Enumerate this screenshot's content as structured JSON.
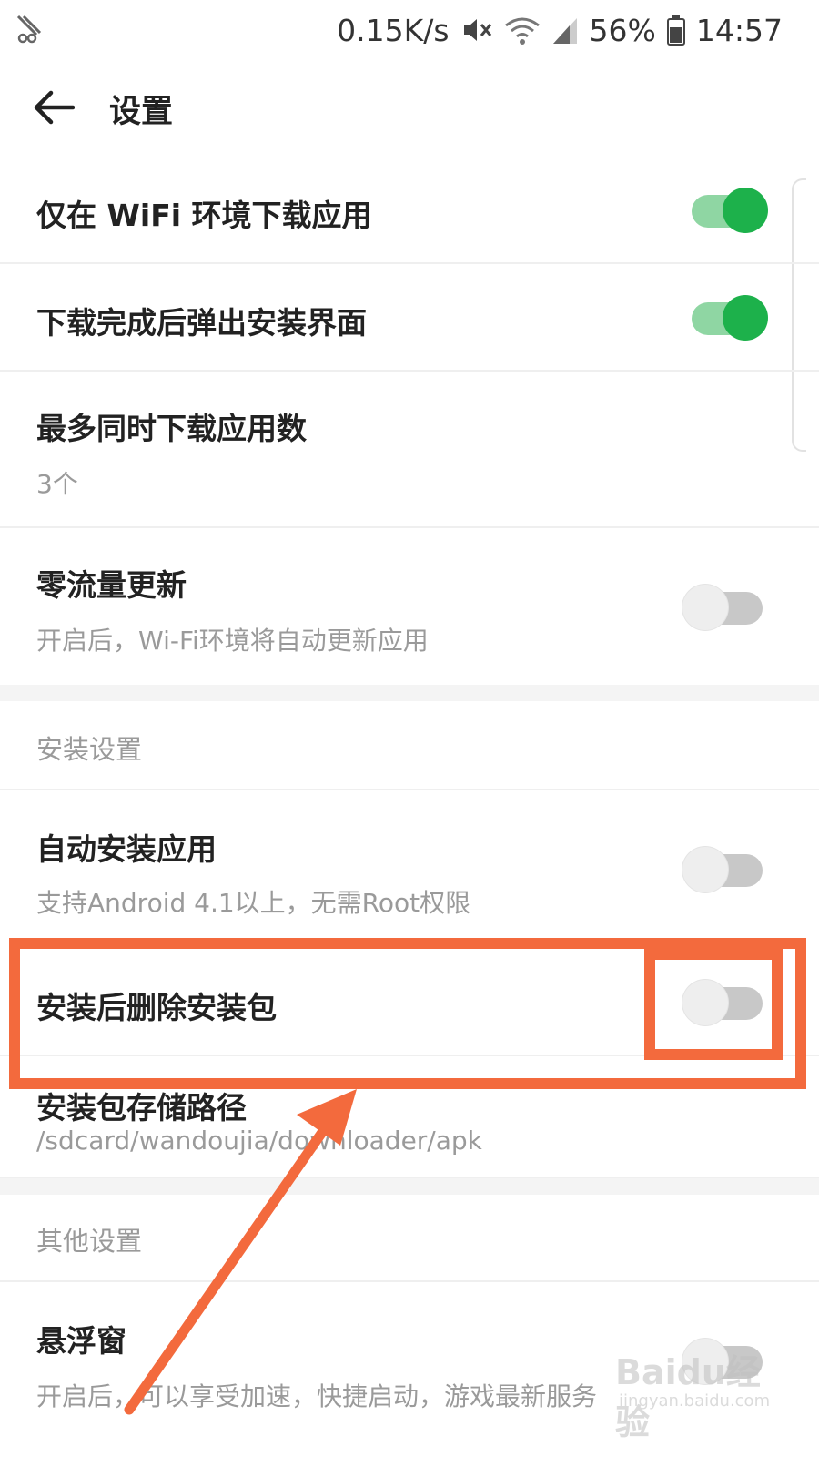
{
  "status_bar": {
    "net_speed": "0.15K/s",
    "battery_percent": "56%",
    "time": "14:57",
    "icons": [
      "app-notification-icon",
      "mute-icon",
      "wifi-icon",
      "signal-icon",
      "battery-icon"
    ]
  },
  "header": {
    "title": "设置",
    "back_icon": "arrow-left-icon"
  },
  "settings": {
    "wifi_only": {
      "title": "仅在 WiFi 环境下载应用",
      "enabled": true
    },
    "popup_install": {
      "title": "下载完成后弹出安装界面",
      "enabled": true
    },
    "max_downloads": {
      "title": "最多同时下载应用数",
      "value": "3个"
    },
    "zero_traffic": {
      "title": "零流量更新",
      "subtitle": "开启后，Wi-Fi环境将自动更新应用",
      "enabled": false
    }
  },
  "install_section": {
    "label": "安装设置",
    "auto_install": {
      "title": "自动安装应用",
      "subtitle": "支持Android 4.1以上，无需Root权限",
      "enabled": false
    },
    "delete_after_install": {
      "title": "安装后删除安装包",
      "enabled": false
    },
    "storage_path": {
      "title": "安装包存储路径",
      "value": "/sdcard/wandoujia/downloader/apk"
    }
  },
  "other_section": {
    "label": "其他设置",
    "floating_window": {
      "title": "悬浮窗",
      "subtitle": "开启后，可以享受加速，快捷启动，游戏最新服务",
      "enabled": false
    }
  },
  "annotation": {
    "highlight_color": "#f36a3d"
  },
  "watermark": {
    "brand": "Baidu经验",
    "url": "jingyan.baidu.com"
  },
  "colors": {
    "toggle_on": "#1db14b",
    "toggle_on_track": "#8fd6a3",
    "toggle_off_track": "#c8c8c8",
    "subtitle": "#9a9a9a"
  }
}
